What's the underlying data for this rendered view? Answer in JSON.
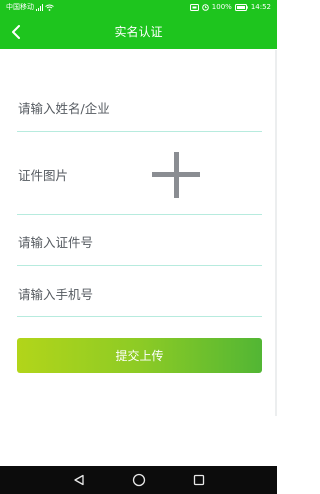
{
  "status_bar": {
    "carrier": "中国移动",
    "battery_percent": "100%",
    "time": "14:52"
  },
  "header": {
    "title": "实名认证"
  },
  "form": {
    "name_placeholder": "请输入姓名/企业",
    "id_image_label": "证件图片",
    "id_number_placeholder": "请输入证件号",
    "phone_placeholder": "请输入手机号",
    "submit_label": "提交上传"
  },
  "colors": {
    "header_green": "#1ec51e",
    "field_underline": "#b7ebde",
    "button_gradient_start": "#b2d51a",
    "button_gradient_end": "#52b634"
  },
  "icons": {
    "back": "chevron-left-icon",
    "upload": "plus-icon",
    "nav_back": "triangle-back-icon",
    "nav_home": "circle-home-icon",
    "nav_recent": "square-recent-icon"
  }
}
